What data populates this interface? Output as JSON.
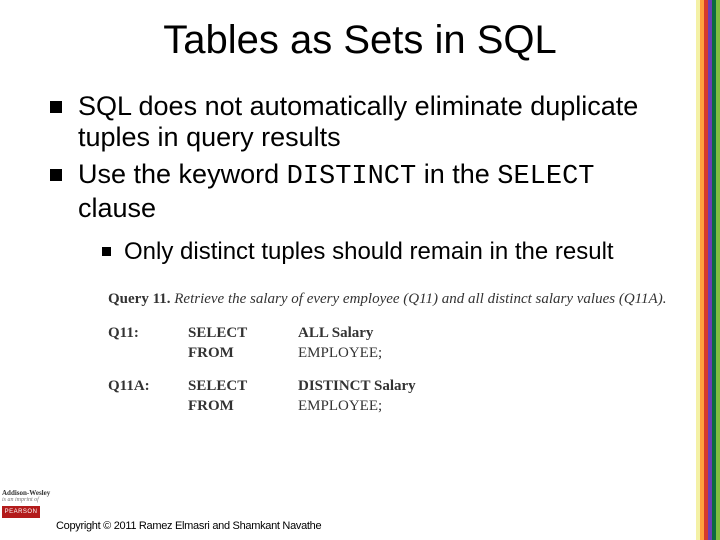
{
  "title": "Tables as Sets in SQL",
  "bullets": {
    "b1": "SQL does not automatically eliminate duplicate tuples in query results",
    "b2_pre": "Use the keyword ",
    "b2_kw1": "DISTINCT",
    "b2_mid": " in the ",
    "b2_kw2": "SELECT",
    "b2_post": " clause",
    "sub1": "Only distinct tuples should remain in the result"
  },
  "query": {
    "header_label": "Query 11.",
    "header_desc": " Retrieve the salary of every employee (Q11) and all distinct salary values (Q11A).",
    "q11": {
      "id": "Q11:",
      "l1_kw": "SELECT",
      "l1_arg": "ALL Salary",
      "l2_kw": "FROM",
      "l2_arg": "EMPLOYEE;"
    },
    "q11a": {
      "id": "Q11A:",
      "l1_kw": "SELECT",
      "l1_arg": "DISTINCT Salary",
      "l2_kw": "FROM",
      "l2_arg": "EMPLOYEE;"
    }
  },
  "footer": {
    "publisher_line1": "Addison-Wesley",
    "publisher_line2": "is an imprint of",
    "publisher_brand": "PEARSON",
    "copyright": "Copyright © 2011 Ramez Elmasri and Shamkant Navathe"
  }
}
